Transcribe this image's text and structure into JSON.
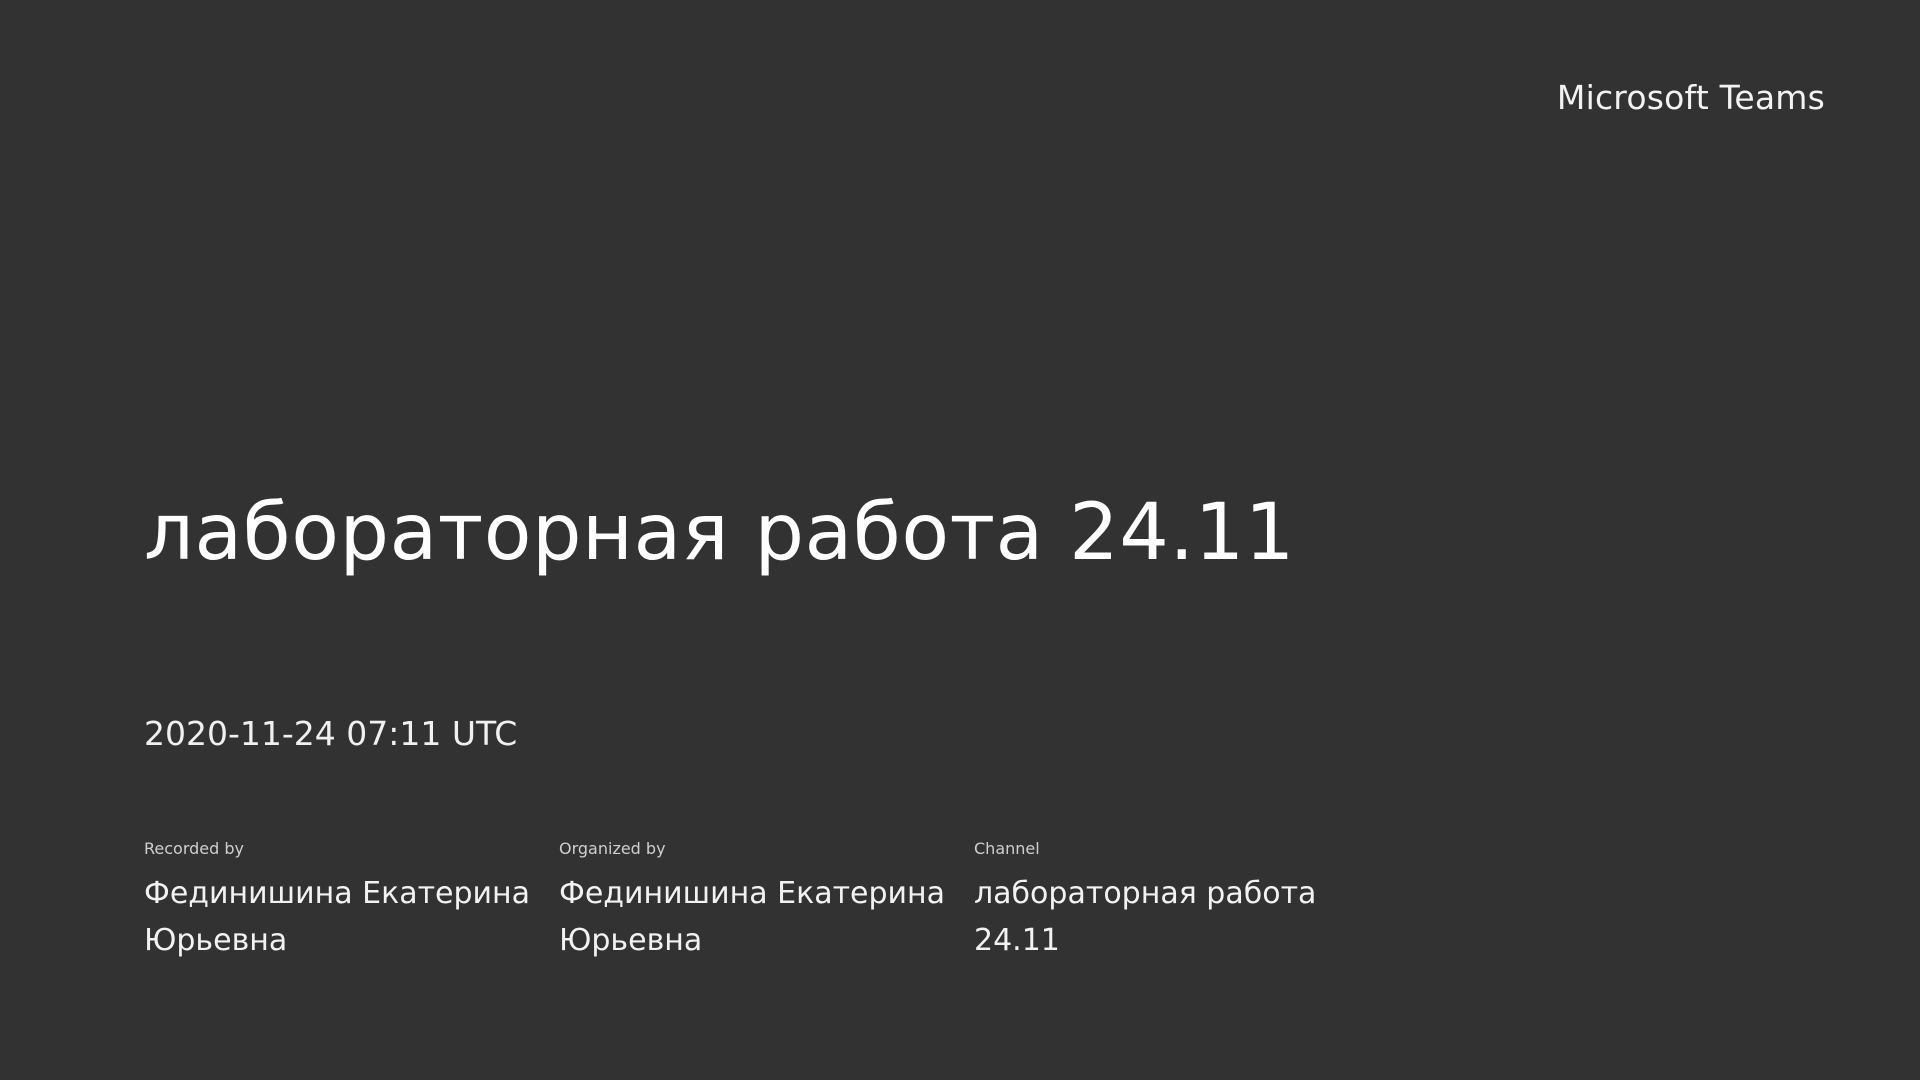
{
  "brand": {
    "name": "Microsoft Teams"
  },
  "recording": {
    "title": "лабораторная работа 24.11",
    "timestamp": "2020-11-24 07:11 UTC"
  },
  "details": [
    {
      "label": "Recorded by",
      "value": "Фединишина Екатерина Юрьевна"
    },
    {
      "label": "Organized by",
      "value": "Фединишина Екатерина Юрьевна"
    },
    {
      "label": "Channel",
      "value": "лабораторная работа 24.11"
    }
  ],
  "colors": {
    "background": "#323232",
    "text": "#f2f2f2"
  }
}
